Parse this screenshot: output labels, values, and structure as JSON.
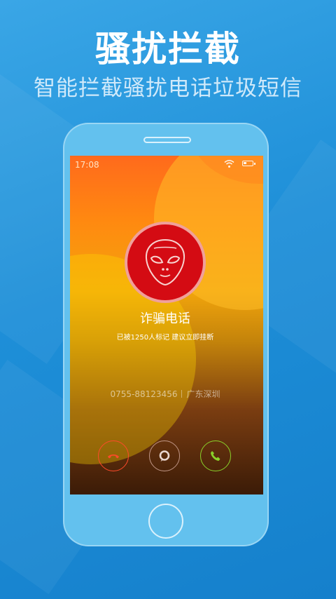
{
  "promo": {
    "title": "骚扰拦截",
    "subtitle": "智能拦截骚扰电话垃圾短信"
  },
  "phone_screen": {
    "status_bar": {
      "time": "17:08",
      "wifi_icon": "wifi-icon",
      "battery_icon": "battery-icon"
    },
    "caller": {
      "avatar_icon": "alien-icon",
      "label": "诈骗电话",
      "warning": "已被1250人标记 建议立即挂断",
      "number": "0755-88123456",
      "location": "广东深圳"
    },
    "actions": {
      "hangup_icon": "hang-up-icon",
      "message_icon": "message-icon",
      "answer_icon": "answer-icon"
    }
  },
  "colors": {
    "background_blue": "#1e8fd8",
    "phone_body": "#63c1ee",
    "avatar_red": "#d40b13",
    "hangup_red": "#ff4a2a",
    "answer_green": "#8ad12a"
  }
}
